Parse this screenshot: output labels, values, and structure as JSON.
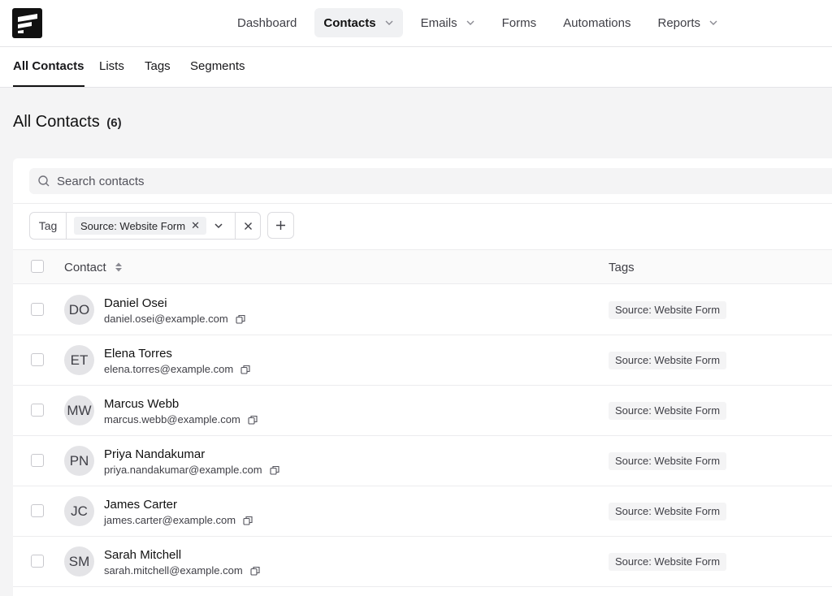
{
  "nav": {
    "items": [
      {
        "label": "Dashboard",
        "dropdown": false,
        "active": false
      },
      {
        "label": "Contacts",
        "dropdown": true,
        "active": true
      },
      {
        "label": "Emails",
        "dropdown": true,
        "active": false
      },
      {
        "label": "Forms",
        "dropdown": false,
        "active": false
      },
      {
        "label": "Automations",
        "dropdown": false,
        "active": false
      },
      {
        "label": "Reports",
        "dropdown": true,
        "active": false
      }
    ]
  },
  "subtabs": [
    {
      "label": "All Contacts",
      "active": true
    },
    {
      "label": "Lists",
      "active": false
    },
    {
      "label": "Tags",
      "active": false
    },
    {
      "label": "Segments",
      "active": false
    }
  ],
  "page": {
    "title": "All Contacts",
    "count": "(6)"
  },
  "search": {
    "placeholder": "Search contacts",
    "value": ""
  },
  "filter": {
    "label": "Tag",
    "chip": "Source: Website Form"
  },
  "table": {
    "columns": {
      "contact": "Contact",
      "tags": "Tags"
    },
    "rows": [
      {
        "initials": "DO",
        "name": "Daniel Osei",
        "email": "daniel.osei@example.com",
        "tag": "Source: Website Form"
      },
      {
        "initials": "ET",
        "name": "Elena Torres",
        "email": "elena.torres@example.com",
        "tag": "Source: Website Form"
      },
      {
        "initials": "MW",
        "name": "Marcus Webb",
        "email": "marcus.webb@example.com",
        "tag": "Source: Website Form"
      },
      {
        "initials": "PN",
        "name": "Priya Nandakumar",
        "email": "priya.nandakumar@example.com",
        "tag": "Source: Website Form"
      },
      {
        "initials": "JC",
        "name": "James Carter",
        "email": "james.carter@example.com",
        "tag": "Source: Website Form"
      },
      {
        "initials": "SM",
        "name": "Sarah Mitchell",
        "email": "sarah.mitchell@example.com",
        "tag": "Source: Website Form"
      }
    ]
  },
  "colors": {
    "accent": "#111111",
    "background": "#f4f4f5",
    "surface": "#ffffff"
  }
}
